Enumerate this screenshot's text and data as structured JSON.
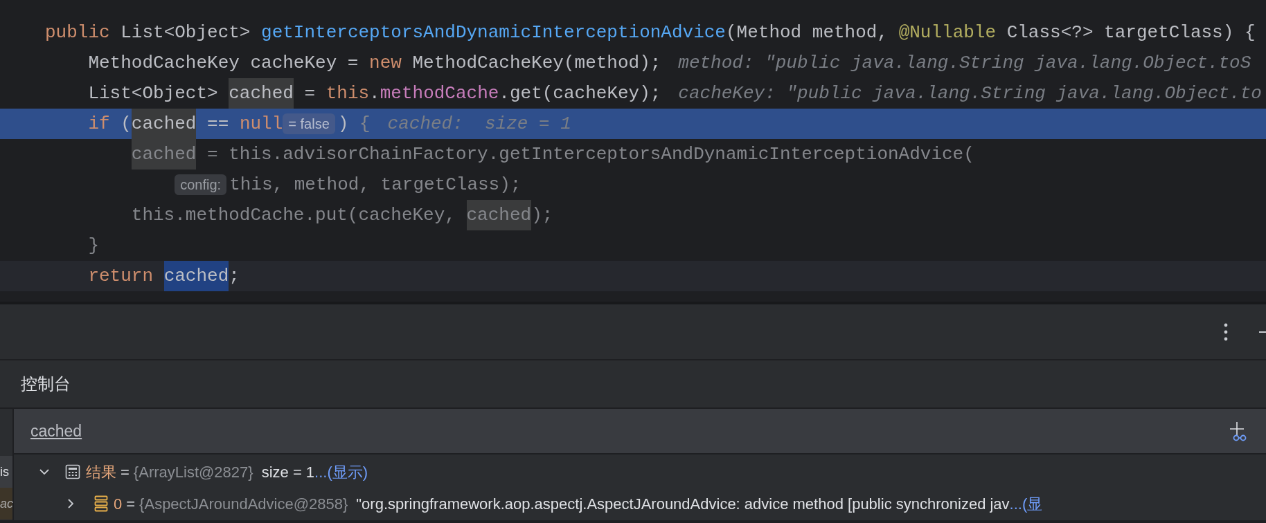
{
  "editor": {
    "lines": [
      {
        "current": false,
        "caret": false,
        "tokens": [
          {
            "kind": "keyword",
            "text": "public"
          },
          {
            "kind": "plain",
            "text": " List<Object> "
          },
          {
            "kind": "decl",
            "text": "getInterceptorsAndDynamicInterceptionAdvice"
          },
          {
            "kind": "plain",
            "text": "(Method method, "
          },
          {
            "kind": "annotation",
            "text": "@Nullable"
          },
          {
            "kind": "plain",
            "text": " Class<?> targetClass) {"
          }
        ],
        "children": [
          {
            "current": false,
            "caret": false,
            "tokens": [
              {
                "kind": "plain",
                "text": "MethodCacheKey cacheKey = "
              },
              {
                "kind": "keyword",
                "text": "new"
              },
              {
                "kind": "plain",
                "text": " MethodCacheKey(method);"
              },
              {
                "kind": "hint",
                "text": "method: \"public java.lang.String java.lang.Object.toS"
              }
            ]
          },
          {
            "current": false,
            "caret": false,
            "tokens": [
              {
                "kind": "plain",
                "text": "List<Object> "
              },
              {
                "kind": "usage",
                "text": "cached"
              },
              {
                "kind": "plain",
                "text": " = "
              },
              {
                "kind": "keyword",
                "text": "this"
              },
              {
                "kind": "plain",
                "text": "."
              },
              {
                "kind": "field",
                "text": "methodCache"
              },
              {
                "kind": "plain",
                "text": ".get(cacheKey);"
              },
              {
                "kind": "hint",
                "text": "cacheKey: \"public java.lang.String java.lang.Object.to"
              }
            ]
          },
          {
            "current": true,
            "caret": false,
            "tokens": [
              {
                "kind": "keyword",
                "text": "if"
              },
              {
                "kind": "plain",
                "text": " ("
              },
              {
                "kind": "usage",
                "text": "cached"
              },
              {
                "kind": "plain",
                "text": " == "
              },
              {
                "kind": "keyword",
                "text": "null"
              },
              {
                "kind": "inlay",
                "text": "= false"
              },
              {
                "kind": "plain",
                "text": ") "
              },
              {
                "kind": "dim",
                "text": "{"
              },
              {
                "kind": "hint",
                "text": "cached:  size = 1"
              }
            ],
            "children": [
              {
                "current": false,
                "caret": false,
                "tokens": [
                  {
                    "kind": "usage-dim",
                    "text": "cached"
                  },
                  {
                    "kind": "dim",
                    "text": " = this.advisorChainFactory.getInterceptorsAndDynamicInterceptionAdvice("
                  }
                ],
                "children": [
                  {
                    "current": false,
                    "caret": false,
                    "tokens": [
                      {
                        "kind": "inlay",
                        "text": "config:"
                      },
                      {
                        "kind": "dim",
                        "text": "this, method, targetClass);"
                      }
                    ]
                  }
                ]
              },
              {
                "current": false,
                "caret": false,
                "tokens": [
                  {
                    "kind": "dim",
                    "text": "this.methodCache.put(cacheKey, "
                  },
                  {
                    "kind": "usage-dim",
                    "text": "cached"
                  },
                  {
                    "kind": "dim",
                    "text": ");"
                  }
                ]
              }
            ]
          },
          {
            "current": false,
            "caret": false,
            "tokens": [
              {
                "kind": "dim",
                "text": "}"
              }
            ]
          },
          {
            "current": false,
            "caret": true,
            "tokens": [
              {
                "kind": "keyword",
                "text": "return "
              },
              {
                "kind": "selection",
                "text": "cached"
              },
              {
                "kind": "plain",
                "text": ";"
              }
            ]
          }
        ]
      }
    ]
  },
  "panel": {
    "tab_title": "控制台",
    "frames": [
      {
        "text": "is",
        "kind": "plain"
      },
      {
        "text": "ac",
        "kind": "library"
      }
    ],
    "evaluate": {
      "value": "cached"
    },
    "tree": [
      {
        "kind": "array",
        "expanded": true,
        "name": "结果",
        "equals": "=",
        "type": "{ArrayList@2827}",
        "value": "size = 1",
        "link": "...(显示)"
      },
      {
        "kind": "element",
        "expanded": false,
        "name": "0",
        "equals": "=",
        "type": "{AspectJAroundAdvice@2858}",
        "value": "\"org.springframework.aop.aspectj.AspectJAroundAdvice: advice method [public synchronized jav",
        "link": "...(显"
      }
    ]
  }
}
